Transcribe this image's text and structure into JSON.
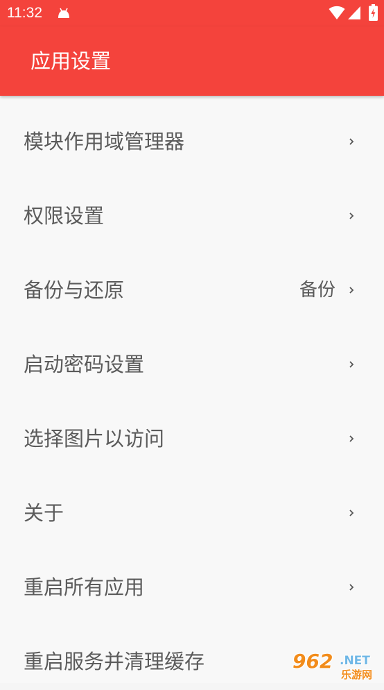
{
  "status_bar": {
    "time": "11:32",
    "icons": [
      "android-icon",
      "wifi-icon",
      "signal-icon",
      "battery-charging-icon"
    ]
  },
  "app_bar": {
    "title": "应用设置"
  },
  "settings": {
    "items": [
      {
        "label": "模块作用域管理器",
        "value": "",
        "icon": "chevron-right-icon"
      },
      {
        "label": "权限设置",
        "value": "",
        "icon": "chevron-right-icon"
      },
      {
        "label": "备份与还原",
        "value": "备份",
        "icon": "chevron-right-icon"
      },
      {
        "label": "启动密码设置",
        "value": "",
        "icon": "chevron-right-icon"
      },
      {
        "label": "选择图片以访问",
        "value": "",
        "icon": "chevron-right-icon"
      },
      {
        "label": "关于",
        "value": "",
        "icon": "chevron-right-icon"
      },
      {
        "label": "重启所有应用",
        "value": "",
        "icon": "chevron-right-icon"
      },
      {
        "label": "重启服务并清理缓存",
        "value": "",
        "icon": "chevron-right-icon"
      }
    ]
  },
  "watermark": {
    "number": "962",
    "domain": ".NET",
    "site": "乐游网"
  },
  "colors": {
    "primary": "#f4433c",
    "list_background": "#f8f8f8",
    "text": "#5b5b5b"
  }
}
